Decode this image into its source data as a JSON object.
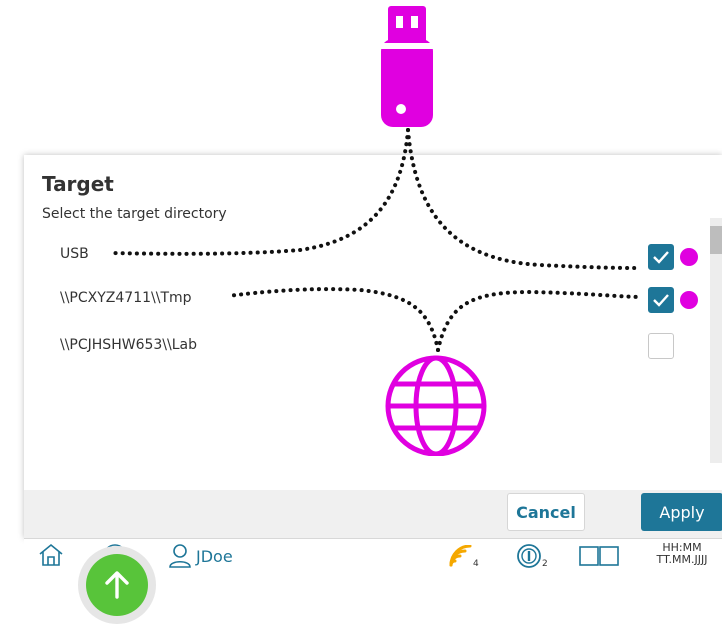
{
  "dialog": {
    "title": "Target",
    "subtitle": "Select the target directory",
    "rows": [
      {
        "label": "USB",
        "checked": true
      },
      {
        "label": "\\\\PCXYZ4711\\\\Tmp",
        "checked": true
      },
      {
        "label": "\\\\PCJHSHW653\\\\Lab",
        "checked": false
      }
    ],
    "cancel_label": "Cancel",
    "apply_label": "Apply"
  },
  "statusbar": {
    "user": "JDoe",
    "wifi_count": "4",
    "info_count": "2",
    "clock_time": "HH:MM",
    "clock_date": "TT.MM.JJJJ"
  },
  "colors": {
    "accent": "#1e7698",
    "highlight": "#e000e0",
    "fab": "#58c43a"
  },
  "icons": [
    "usb-stick-icon",
    "globe-icon",
    "home-icon",
    "logout-icon",
    "user-icon",
    "wifi-signal-icon",
    "info-icon",
    "book-icon",
    "arrow-up-icon",
    "checkmark-icon"
  ]
}
